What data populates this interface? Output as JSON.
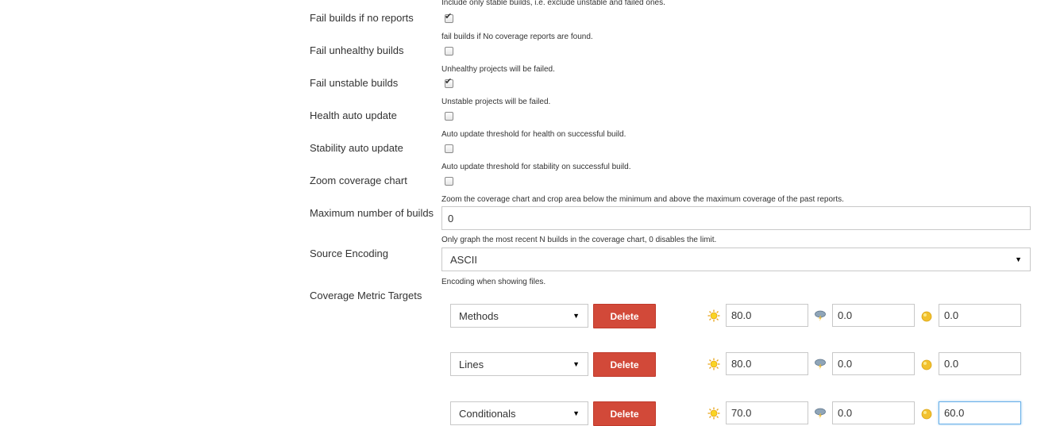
{
  "top_help": "Include only stable builds, i.e. exclude unstable and failed ones.",
  "options": [
    {
      "label": "Fail builds if no reports",
      "checked": true,
      "help": "fail builds if No coverage reports are found."
    },
    {
      "label": "Fail unhealthy builds",
      "checked": false,
      "help": "Unhealthy projects will be failed."
    },
    {
      "label": "Fail unstable builds",
      "checked": true,
      "help": "Unstable projects will be failed."
    },
    {
      "label": "Health auto update",
      "checked": false,
      "help": "Auto update threshold for health on successful build."
    },
    {
      "label": "Stability auto update",
      "checked": false,
      "help": "Auto update threshold for stability on successful build."
    },
    {
      "label": "Zoom coverage chart",
      "checked": false,
      "help": "Zoom the coverage chart and crop area below the minimum and above the maximum coverage of the past reports."
    }
  ],
  "max_builds": {
    "label": "Maximum number of builds",
    "value": "0",
    "help": "Only graph the most recent N builds in the coverage chart, 0 disables the limit."
  },
  "source_encoding": {
    "label": "Source Encoding",
    "value": "ASCII",
    "help": "Encoding when showing files."
  },
  "coverage_targets": {
    "label": "Coverage Metric Targets",
    "delete_label": "Delete",
    "rows": [
      {
        "metric": "Methods",
        "healthy": "80.0",
        "unhealthy": "0.0",
        "unstable": "0.0"
      },
      {
        "metric": "Lines",
        "healthy": "80.0",
        "unhealthy": "0.0",
        "unstable": "0.0"
      },
      {
        "metric": "Conditionals",
        "healthy": "70.0",
        "unhealthy": "0.0",
        "unstable": "60.0"
      }
    ]
  },
  "icons": {
    "healthy": "sun-icon",
    "unhealthy": "storm-cloud-icon",
    "unstable": "yellow-ball-icon"
  }
}
